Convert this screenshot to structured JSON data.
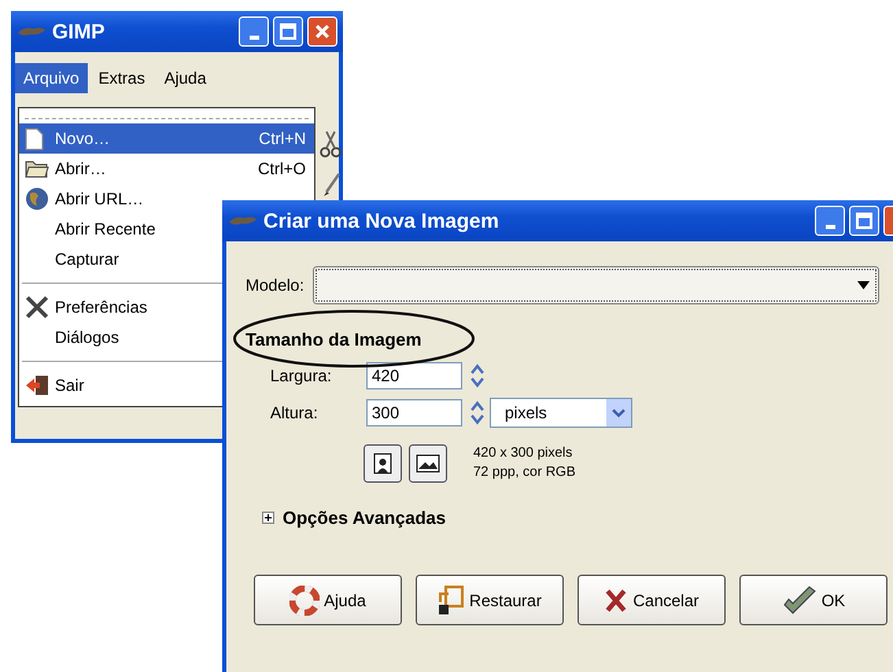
{
  "gimp_window": {
    "title": "GIMP",
    "menubar": [
      {
        "label": "Arquivo",
        "selected": true
      },
      {
        "label": "Extras",
        "selected": false
      },
      {
        "label": "Ajuda",
        "selected": false
      }
    ],
    "menu": [
      {
        "kind": "item",
        "label": "Novo…",
        "shortcut": "Ctrl+N",
        "selected": true
      },
      {
        "kind": "item",
        "label": "Abrir…",
        "shortcut": "Ctrl+O",
        "selected": false
      },
      {
        "kind": "item",
        "label": "Abrir URL…",
        "selected": false
      },
      {
        "kind": "item",
        "label": "Abrir Recente",
        "selected": false
      },
      {
        "kind": "item",
        "label": "Capturar",
        "selected": false
      },
      {
        "kind": "separator"
      },
      {
        "kind": "item",
        "label": "Preferências",
        "selected": false
      },
      {
        "kind": "item",
        "label": "Diálogos",
        "selected": false
      },
      {
        "kind": "separator"
      },
      {
        "kind": "item",
        "label": "Sair",
        "selected": false
      }
    ]
  },
  "dialog": {
    "title": "Criar uma Nova Imagem",
    "template_label": "Modelo:",
    "section_title": "Tamanho da Imagem",
    "width": {
      "label": "Largura:",
      "value": "420"
    },
    "height": {
      "label": "Altura:",
      "value": "300"
    },
    "unit": "pixels",
    "info": [
      "420 x 300 pixels",
      "72 ppp, cor RGB"
    ],
    "advanced": {
      "label": "Opções Avançadas",
      "expanded": false
    },
    "buttons": [
      "Ajuda",
      "Restaurar",
      "Cancelar",
      "OK"
    ]
  }
}
